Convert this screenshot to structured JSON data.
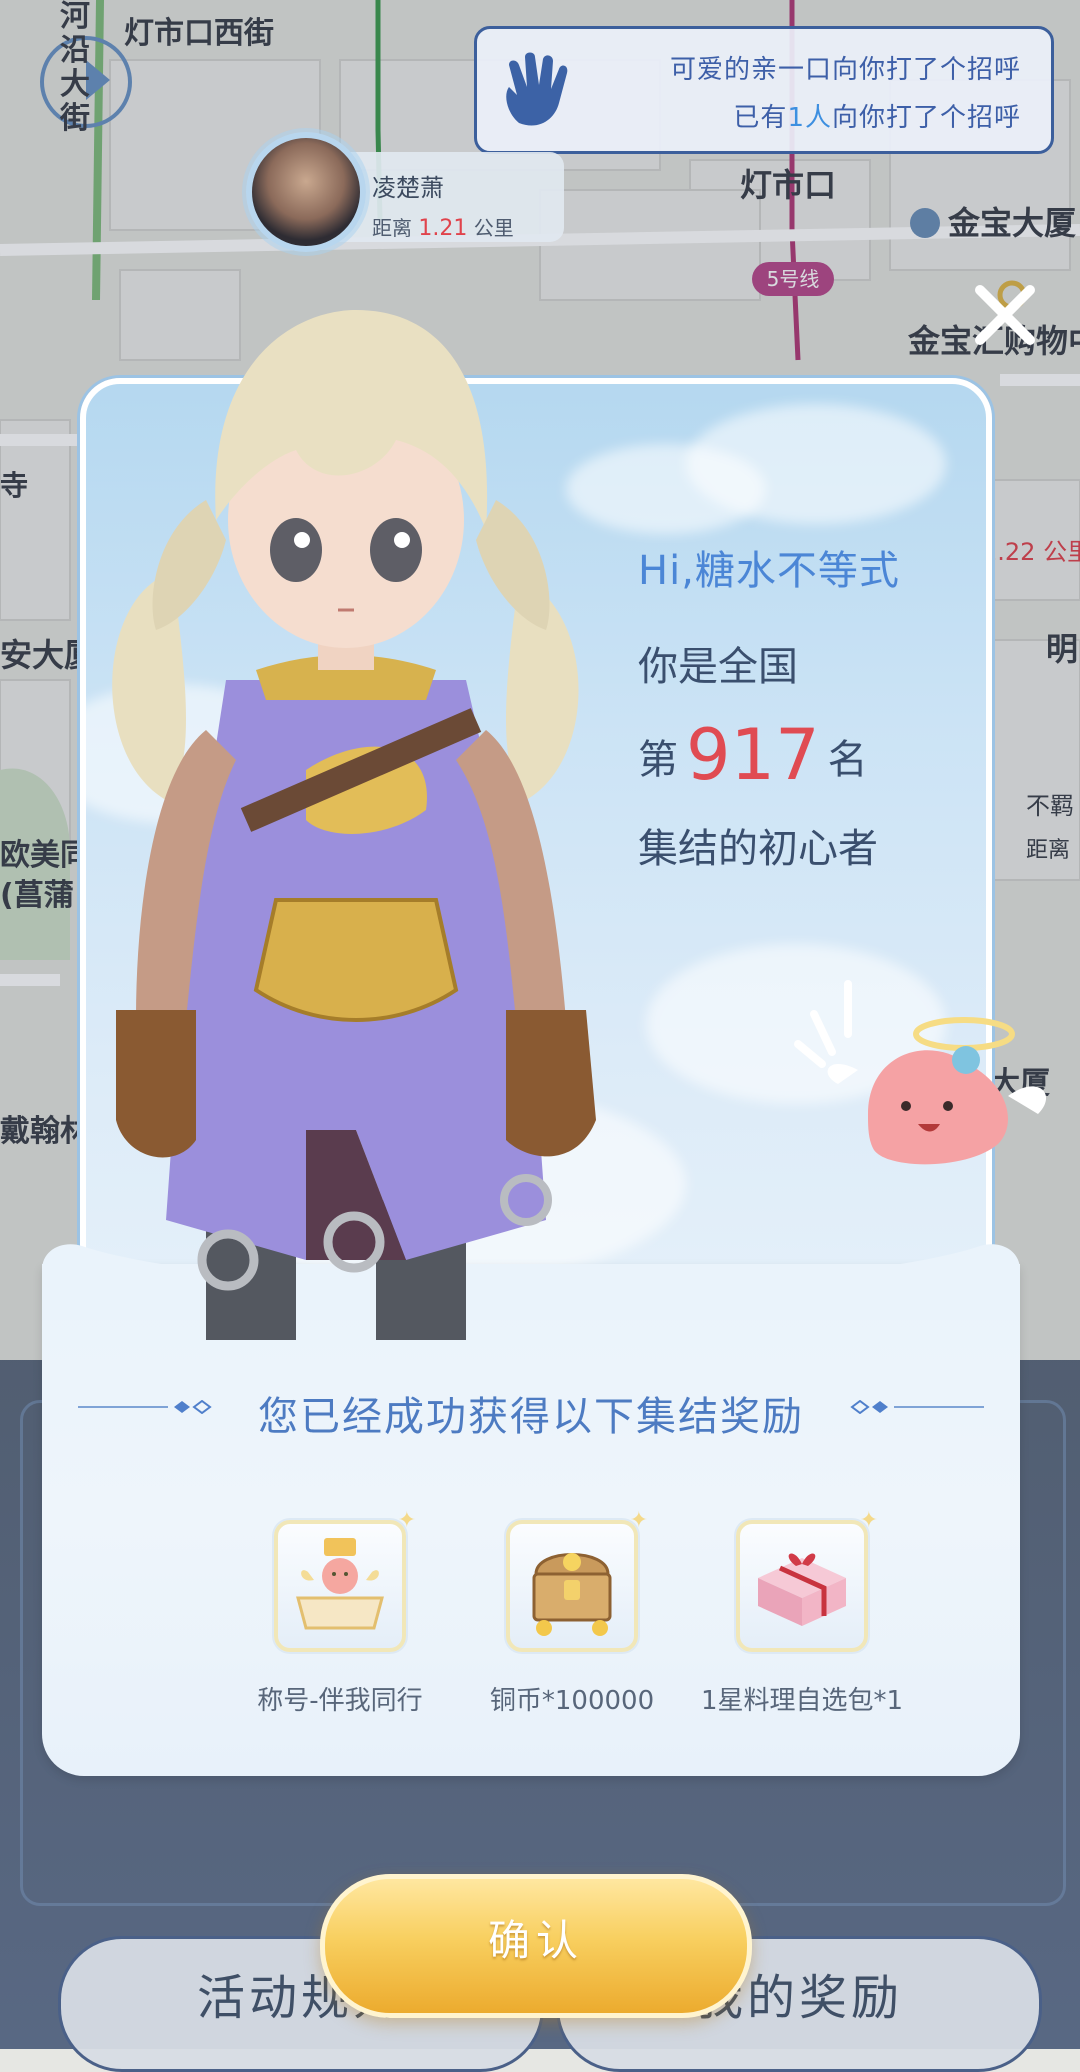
{
  "map": {
    "streets": [
      "河沿大街",
      "灯市口西街",
      "灯市口",
      "金宝大厦",
      "5号线",
      "金宝汇购物中",
      "安大厦",
      "明",
      "欧美同",
      "(菖蒲",
      "翰林",
      "大厦",
      "寺",
      "公里"
    ],
    "right_distance": "1.22",
    "right_user_fragment": "不羁",
    "right_user_distance_label": "距离"
  },
  "greeting_bubble": {
    "line1_pre": "可爱的亲一口",
    "line1_post": "向你打了个招呼",
    "line2_pre": "已有",
    "line2_count": "1人",
    "line2_post": "向你打了个招呼"
  },
  "nearby_user": {
    "name": "凌楚萧",
    "distance_label": "距离",
    "distance_value": "1.21",
    "distance_unit": "公里"
  },
  "modal": {
    "hi": "Hi,糖水不等式",
    "nation": "你是全国",
    "rank_prefix": "第",
    "rank_number": "917",
    "rank_suffix": "名",
    "pioneer": "集结的初心者",
    "rewards_title": "您已经成功获得以下集结奖励",
    "rewards": [
      {
        "label": "称号-伴我同行",
        "icon": "title-badge-icon"
      },
      {
        "label": "铜币*100000",
        "icon": "treasure-chest-icon"
      },
      {
        "label": "1星料理自选包*1",
        "icon": "gift-box-icon"
      }
    ],
    "confirm": "确认"
  },
  "bottom": {
    "rules": "活动规则",
    "my_rewards": "我的奖励"
  },
  "colors": {
    "accent_blue": "#4b86d6",
    "rank_red": "#e04b52",
    "confirm_gold": "#f3bf45"
  }
}
